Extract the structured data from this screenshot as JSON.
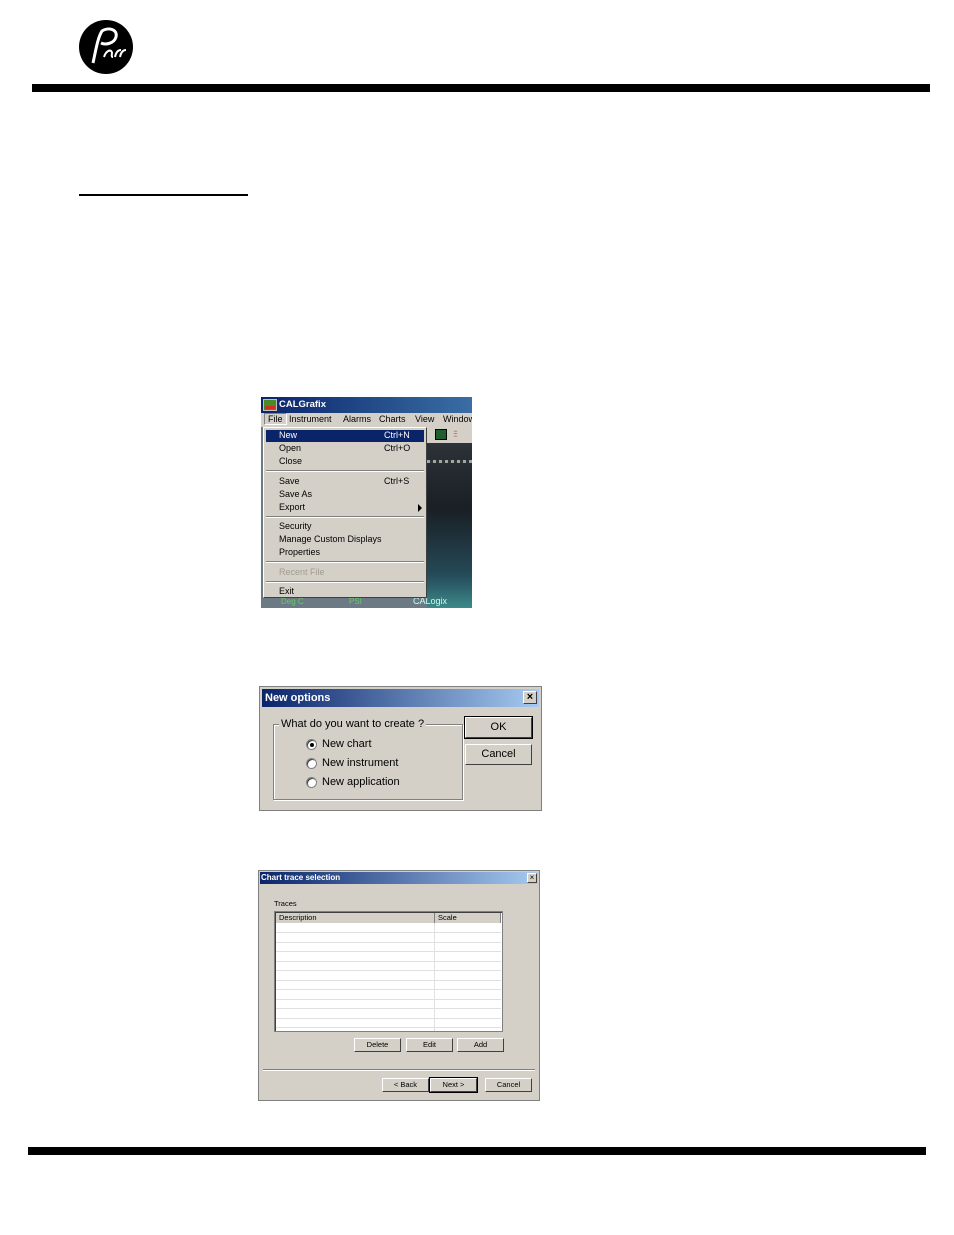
{
  "logo": {
    "text": "Parr"
  },
  "file_menu_screenshot": {
    "title": "CALGrafix",
    "menubar": [
      "File",
      "Instrument",
      "Alarms",
      "Charts",
      "View",
      "Window"
    ],
    "menu_items": [
      {
        "label": "New",
        "shortcut": "Ctrl+N"
      },
      {
        "label": "Open",
        "shortcut": "Ctrl+O"
      },
      {
        "label": "Close",
        "shortcut": ""
      },
      {
        "label": "Save",
        "shortcut": "Ctrl+S"
      },
      {
        "label": "Save As",
        "shortcut": ""
      },
      {
        "label": "Export",
        "shortcut": ""
      },
      {
        "label": "Security",
        "shortcut": ""
      },
      {
        "label": "Manage Custom Displays",
        "shortcut": ""
      },
      {
        "label": "Properties",
        "shortcut": ""
      },
      {
        "label": "Recent File",
        "shortcut": ""
      },
      {
        "label": "Exit",
        "shortcut": ""
      }
    ],
    "background_text": {
      "left": "Deg C",
      "mid": "PSI",
      "right": "CALogix"
    }
  },
  "new_options_dialog": {
    "title": "New options",
    "close": "×",
    "group_label": "What do you want to create ?",
    "options": [
      "New chart",
      "New instrument",
      "New application"
    ],
    "selected": "New chart",
    "ok": "OK",
    "cancel": "Cancel"
  },
  "chart_trace_dialog": {
    "title": "Chart trace selection",
    "close": "×",
    "traces_label": "Traces",
    "columns": [
      "Description",
      "Scale"
    ],
    "buttons": {
      "delete": "Delete",
      "edit": "Edit",
      "add": "Add"
    },
    "nav": {
      "back": "< Back",
      "next": "Next >",
      "cancel": "Cancel"
    }
  }
}
